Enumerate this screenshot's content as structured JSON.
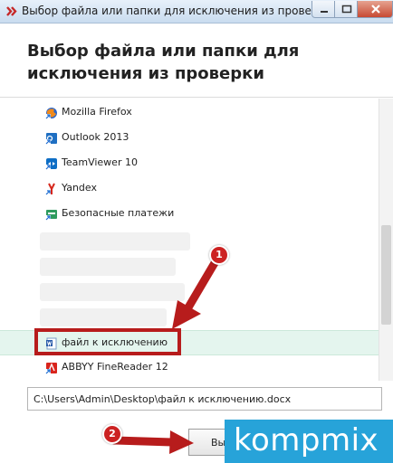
{
  "window": {
    "title": "Выбор файла или папки для исключения из проверки"
  },
  "dialog": {
    "title": "Выбор файла или папки для исключения из проверки"
  },
  "list": {
    "items": [
      {
        "label": "Mozilla Firefox",
        "icon": "firefox-shortcut-icon"
      },
      {
        "label": "Outlook 2013",
        "icon": "outlook-shortcut-icon"
      },
      {
        "label": "TeamViewer 10",
        "icon": "teamviewer-shortcut-icon"
      },
      {
        "label": "Yandex",
        "icon": "yandex-shortcut-icon"
      },
      {
        "label": "Безопасные платежи",
        "icon": "safe-payments-shortcut-icon"
      },
      {
        "label": "файл к исключению",
        "icon": "word-document-icon",
        "selected": true
      },
      {
        "label": "ABBYY FineReader 12",
        "icon": "abbyy-shortcut-icon"
      }
    ]
  },
  "path": {
    "value": "C:\\Users\\Admin\\Desktop\\файл к исключению.docx"
  },
  "buttons": {
    "select_label": "Выб"
  },
  "watermark": {
    "text": "kompmix"
  },
  "annotations": {
    "step1": "1",
    "step2": "2"
  },
  "colors": {
    "annotation_red": "#cc2222",
    "selection_bg": "#e4f5ee",
    "watermark_bg": "#27a3d9"
  }
}
